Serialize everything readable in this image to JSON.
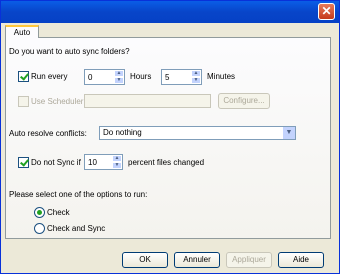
{
  "window": {
    "close_glyph": "✕"
  },
  "tabs": [
    {
      "label": "Auto"
    }
  ],
  "auto": {
    "question": "Do you want to auto sync folders?",
    "run_every": {
      "label": "Run every",
      "checked": true,
      "hours_value": "0",
      "hours_label": "Hours",
      "minutes_value": "5",
      "minutes_label": "Minutes"
    },
    "use_scheduler": {
      "label": "Use Scheduler",
      "checked": false,
      "enabled": false,
      "value": "",
      "configure_label": "Configure..."
    },
    "conflicts": {
      "label": "Auto resolve conflicts:",
      "selected": "Do nothing"
    },
    "do_not_sync": {
      "label": "Do not Sync if",
      "checked": true,
      "value": "10",
      "suffix": "percent files changed"
    },
    "options": {
      "prompt": "Please select one of the options to run:",
      "items": [
        {
          "label": "Check",
          "selected": true
        },
        {
          "label": "Check and Sync",
          "selected": false
        }
      ]
    }
  },
  "buttons": {
    "ok": "OK",
    "cancel": "Annuler",
    "apply": "Appliquer",
    "help": "Aide"
  },
  "colors": {
    "titlebar": "#0a5de6",
    "dialog_bg": "#ece9d8",
    "tab_highlight": "#ffc83c",
    "check_mark": "#21a121"
  }
}
